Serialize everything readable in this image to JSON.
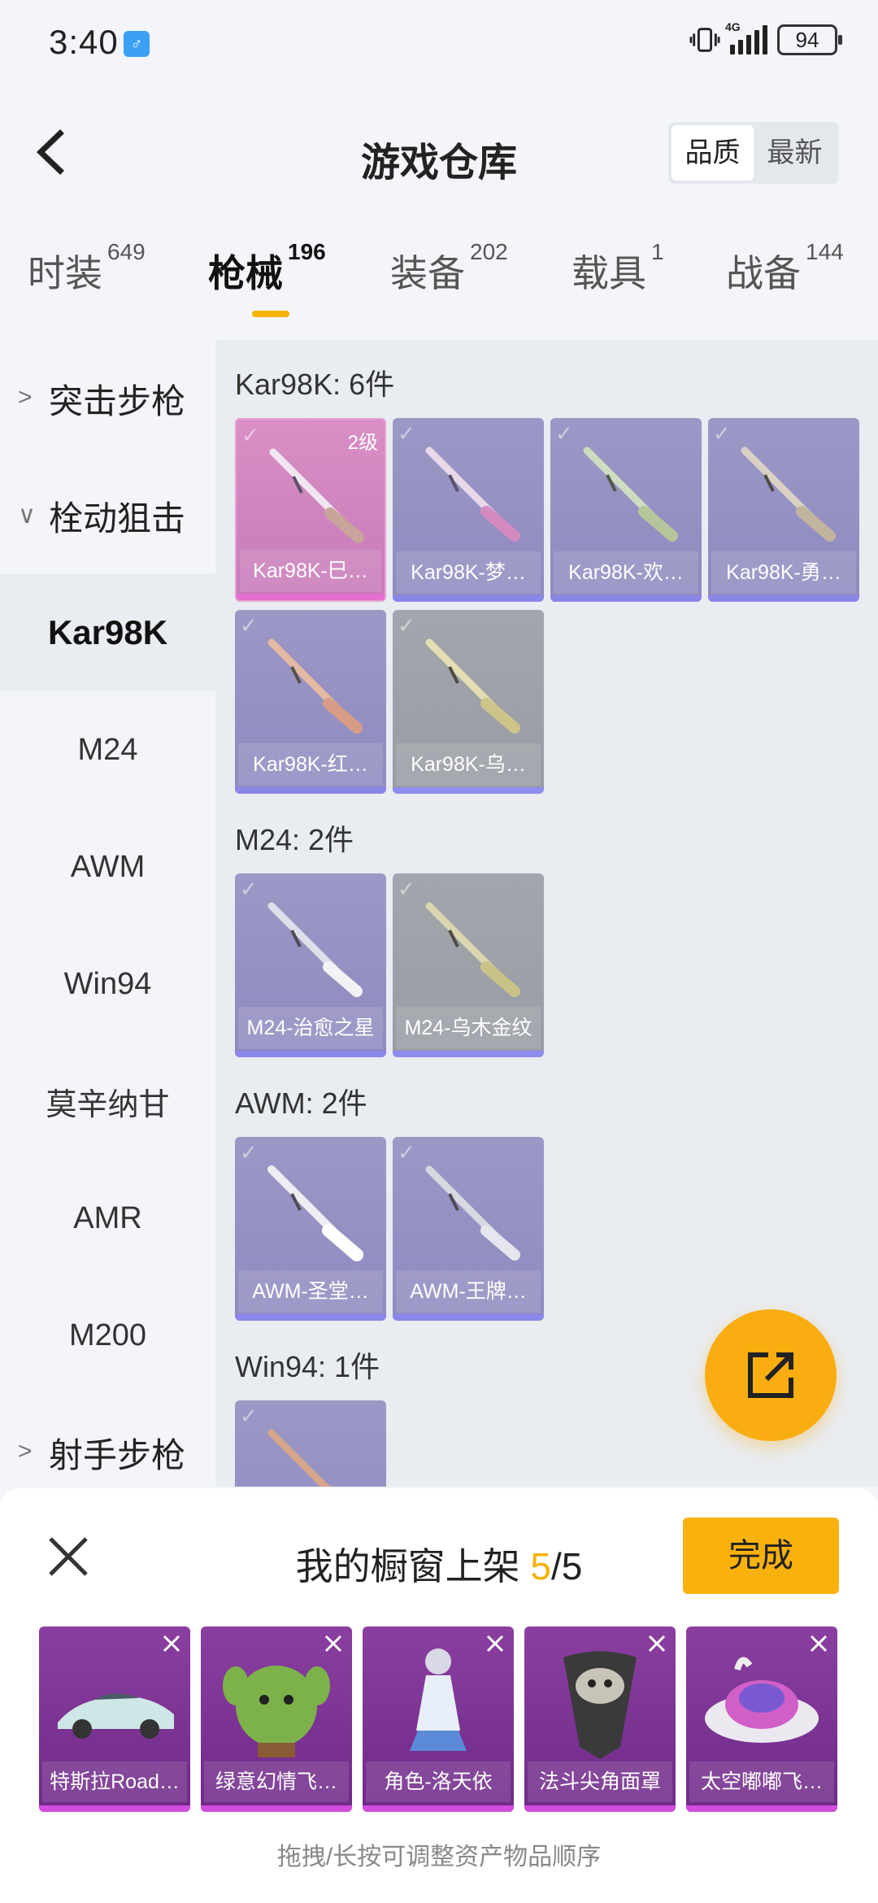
{
  "status_bar": {
    "time": "3:40",
    "notif_glyph": "♂",
    "network": "4G",
    "battery": "94"
  },
  "header": {
    "title": "游戏仓库",
    "sort_options": [
      "品质",
      "最新"
    ]
  },
  "tabs": [
    {
      "label": "时装",
      "count": "649"
    },
    {
      "label": "枪械",
      "count": "196"
    },
    {
      "label": "装备",
      "count": "202"
    },
    {
      "label": "载具",
      "count": "1"
    },
    {
      "label": "战备",
      "count": "144"
    }
  ],
  "sidebar": {
    "group_assault": "突击步枪",
    "group_sniper": "栓动狙击",
    "items": [
      "Kar98K",
      "M24",
      "AWM",
      "Win94",
      "莫辛纳甘",
      "AMR",
      "M200"
    ],
    "group_marksman": "射手步枪"
  },
  "sections": {
    "kar98k": {
      "title": "Kar98K: 6件",
      "items": [
        "Kar98K-巳…",
        "Kar98K-梦…",
        "Kar98K-欢…",
        "Kar98K-勇…",
        "Kar98K-红…",
        "Kar98K-乌…"
      ],
      "level": "2级"
    },
    "m24": {
      "title": "M24: 2件",
      "items": [
        "M24-治愈之星",
        "M24-乌木金纹"
      ]
    },
    "awm": {
      "title": "AWM: 2件",
      "items": [
        "AWM-圣堂…",
        "AWM-王牌…"
      ]
    },
    "win94": {
      "title": "Win94: 1件"
    }
  },
  "panel": {
    "title": "我的橱窗上架",
    "count_current": "5",
    "count_total": "/5",
    "done": "完成",
    "showcase": [
      "特斯拉Road…",
      "绿意幻情飞…",
      "角色-洛天依",
      "法斗尖角面罩",
      "太空嘟嘟飞…"
    ],
    "hint": "拖拽/长按可调整资产物品顺序"
  }
}
